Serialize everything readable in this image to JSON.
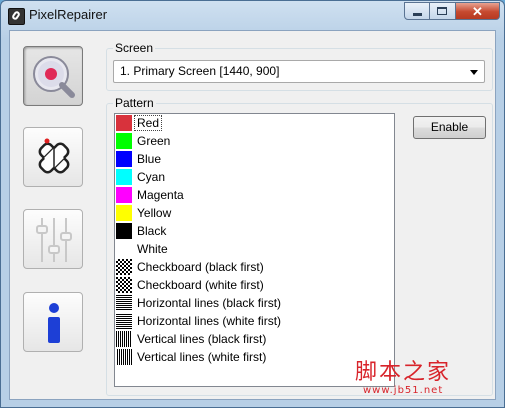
{
  "window": {
    "title": "PixelRepairer",
    "caption_buttons": {
      "close_glyph": "✕"
    }
  },
  "toolbar": [
    {
      "name": "screen-test-icon",
      "active": true
    },
    {
      "name": "pixel-repair-icon",
      "active": false
    },
    {
      "name": "sliders-icon",
      "active": false
    },
    {
      "name": "info-icon",
      "active": false
    }
  ],
  "screen_group": {
    "legend": "Screen",
    "selected": "1. Primary Screen [1440, 900]"
  },
  "pattern_group": {
    "legend": "Pattern",
    "selected_index": 0,
    "items": [
      {
        "label": "Red",
        "swatch": "#d8323c"
      },
      {
        "label": "Green",
        "swatch": "#00ff00"
      },
      {
        "label": "Blue",
        "swatch": "#0000ff"
      },
      {
        "label": "Cyan",
        "swatch": "#00ffff"
      },
      {
        "label": "Magenta",
        "swatch": "#ff00ff"
      },
      {
        "label": "Yellow",
        "swatch": "#ffff00"
      },
      {
        "label": "Black",
        "swatch": "#000000"
      },
      {
        "label": "White",
        "swatch": "#ffffff"
      },
      {
        "label": "Checkboard (black first)",
        "pattern": "pat-cb-black"
      },
      {
        "label": "Checkboard (white first)",
        "pattern": "pat-cb-white"
      },
      {
        "label": "Horizontal lines (black first)",
        "pattern": "pat-h-black"
      },
      {
        "label": "Horizontal lines (white first)",
        "pattern": "pat-h-white"
      },
      {
        "label": "Vertical lines (black first)",
        "pattern": "pat-v-black"
      },
      {
        "label": "Vertical lines (white first)",
        "pattern": "pat-v-white"
      }
    ],
    "enable_button": "Enable"
  },
  "watermark": {
    "main": "脚本之家",
    "url": "www.jb51.net"
  },
  "colors": {
    "watermark": "#d8242b",
    "info_blue": "#1d3fd6",
    "accent_red": "#d8323c"
  }
}
